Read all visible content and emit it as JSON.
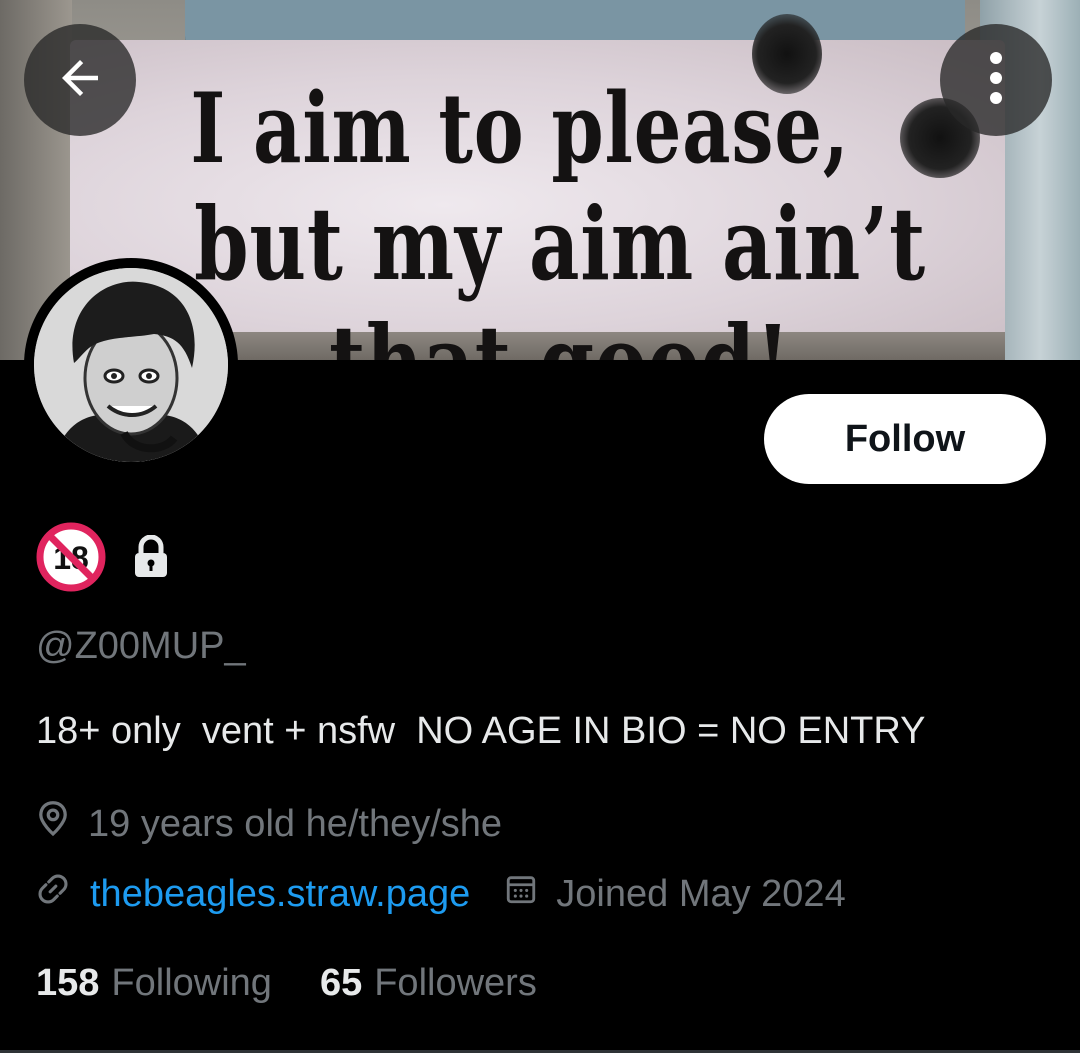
{
  "banner": {
    "sign_line_1": "I aim to please,",
    "sign_line_2": "but my aim ain’t that good!"
  },
  "header": {
    "back_icon": "arrow-left-icon",
    "more_icon": "more-vertical-icon"
  },
  "profile": {
    "follow_label": "Follow",
    "badges": [
      "no-under-18-icon",
      "lock-icon"
    ],
    "handle": "@Z00MUP_",
    "bio": "18+ only  vent + nsfw  NO AGE IN BIO = NO ENTRY",
    "location": "19 years old he/they/she",
    "website": "thebeagles.straw.page",
    "joined": "Joined May 2024",
    "following_count": "158",
    "following_label": "Following",
    "followers_count": "65",
    "followers_label": "Followers"
  },
  "colors": {
    "background": "#000000",
    "text_primary": "#e7e9ea",
    "text_secondary": "#71767b",
    "link": "#1d9bf0",
    "follow_button_bg": "#ffffff"
  }
}
